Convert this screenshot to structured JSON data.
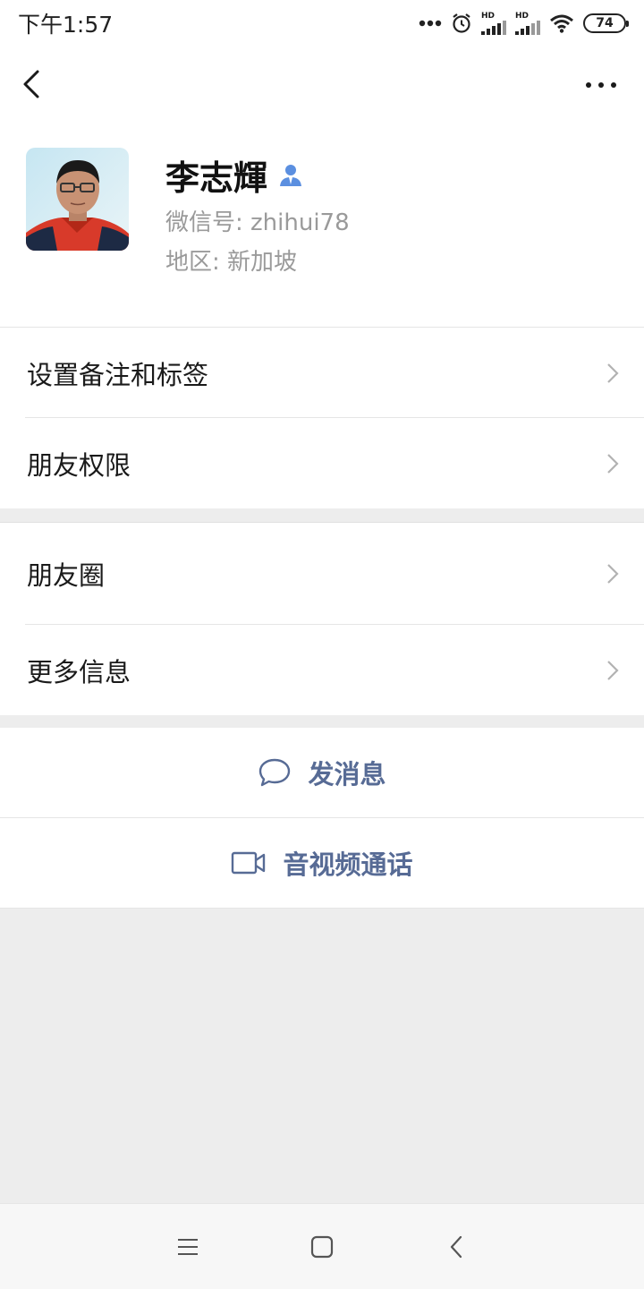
{
  "status_bar": {
    "time": "下午1:57",
    "battery": "74",
    "network_label_1": "HD",
    "network_label_2": "HD"
  },
  "profile": {
    "name": "李志輝",
    "wechat_id": "微信号: zhihui78",
    "region": "地区: 新加坡"
  },
  "menu_group_1": [
    {
      "label": "设置备注和标签"
    },
    {
      "label": "朋友权限"
    }
  ],
  "menu_group_2": [
    {
      "label": "朋友圈"
    },
    {
      "label": "更多信息"
    }
  ],
  "actions": {
    "send_message": "发消息",
    "video_call": "音视频通话"
  },
  "colors": {
    "accent": "#576b95",
    "verified": "#5b8fe0",
    "background": "#ededed"
  },
  "icons": {
    "back": "back-arrow-icon",
    "more": "more-dots-icon",
    "verified": "contact-verified-icon",
    "chevron": "chevron-right-icon",
    "message": "chat-bubble-icon",
    "video": "video-camera-icon"
  }
}
